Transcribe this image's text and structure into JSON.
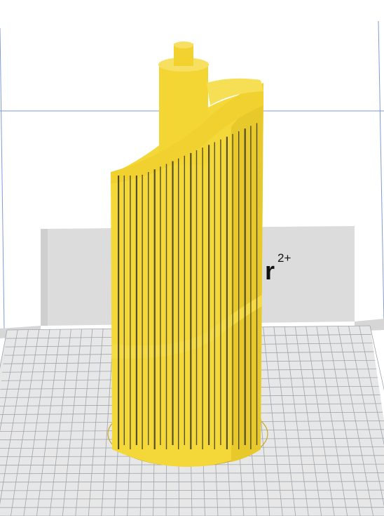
{
  "viewport": {
    "backdrop_label": "r",
    "backdrop_superscript": "2+",
    "colors": {
      "background": "#ffffff",
      "wall": "#dcdcdc",
      "wall_edge": "#c8c8c8",
      "build_plate": "#e6e6e6",
      "grid_line": "#9ea6ad",
      "axis_line": "#6f8fd0",
      "model_yellow": "#f4d83a",
      "model_shadow": "#b89a14",
      "model_gap": "#222222"
    },
    "icons": {
      "model": "spiral-vase-model-icon",
      "plate": "build-plate-grid-icon"
    }
  }
}
